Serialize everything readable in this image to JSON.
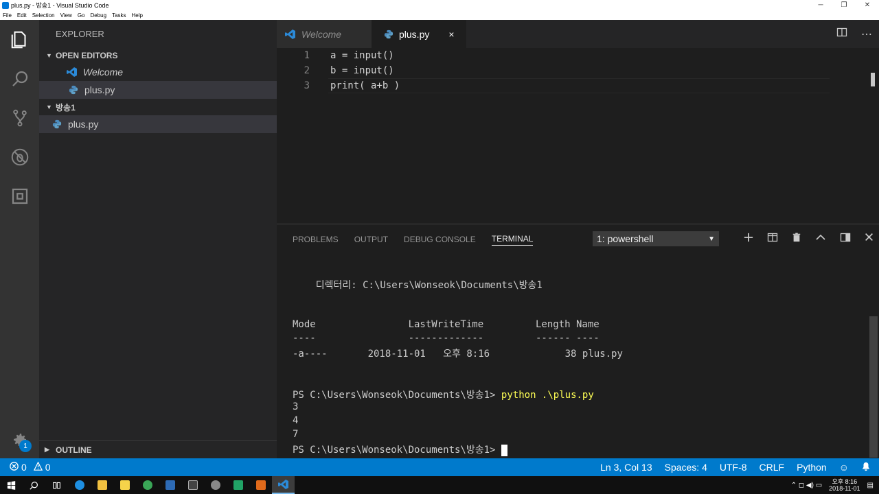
{
  "window": {
    "title": "plus.py - 방송1 - Visual Studio Code"
  },
  "menu": [
    "File",
    "Edit",
    "Selection",
    "View",
    "Go",
    "Debug",
    "Tasks",
    "Help"
  ],
  "activity": [
    "explorer-icon",
    "search-icon",
    "source-control-icon",
    "debug-icon",
    "extensions-icon",
    "gear-icon"
  ],
  "settings_badge": "1",
  "sidebar": {
    "title": "EXPLORER",
    "open_editors_label": "OPEN EDITORS",
    "open_editors": [
      {
        "label": "Welcome",
        "icon": "vscode-icon"
      },
      {
        "label": "plus.py",
        "icon": "python-icon"
      }
    ],
    "folder_label": "방송1",
    "folder_files": [
      {
        "label": "plus.py",
        "icon": "python-icon"
      }
    ],
    "outline_label": "OUTLINE"
  },
  "tabs": [
    {
      "label": "Welcome",
      "active": false
    },
    {
      "label": "plus.py",
      "active": true,
      "close": "×"
    }
  ],
  "editor": {
    "lines": [
      {
        "num": "1",
        "text": "a = input()"
      },
      {
        "num": "2",
        "text": "b = input()"
      },
      {
        "num": "3",
        "text": "print( a+b )"
      }
    ]
  },
  "panel": {
    "tabs": [
      "PROBLEMS",
      "OUTPUT",
      "DEBUG CONSOLE",
      "TERMINAL"
    ],
    "active_tab": "TERMINAL",
    "terminal_select": "1: powershell",
    "terminal_lines": [
      "    디렉터리: C:\\Users\\Wonseok\\Documents\\방송1",
      "",
      "",
      "Mode                LastWriteTime         Length Name",
      "----                -------------         ------ ----",
      "-a----       2018-11-01   오후 8:16             38 plus.py",
      "",
      "",
      "PS C:\\Users\\Wonseok\\Documents\\방송1> ",
      "3",
      "4",
      "7",
      "PS C:\\Users\\Wonseok\\Documents\\방송1> "
    ],
    "command": "python .\\plus.py"
  },
  "status": {
    "errors": "0",
    "warnings": "0",
    "position": "Ln 3, Col 13",
    "spaces": "Spaces: 4",
    "encoding": "UTF-8",
    "eol": "CRLF",
    "language": "Python"
  },
  "taskbar": {
    "time": "오후 8:16",
    "date": "2018-11-01"
  }
}
